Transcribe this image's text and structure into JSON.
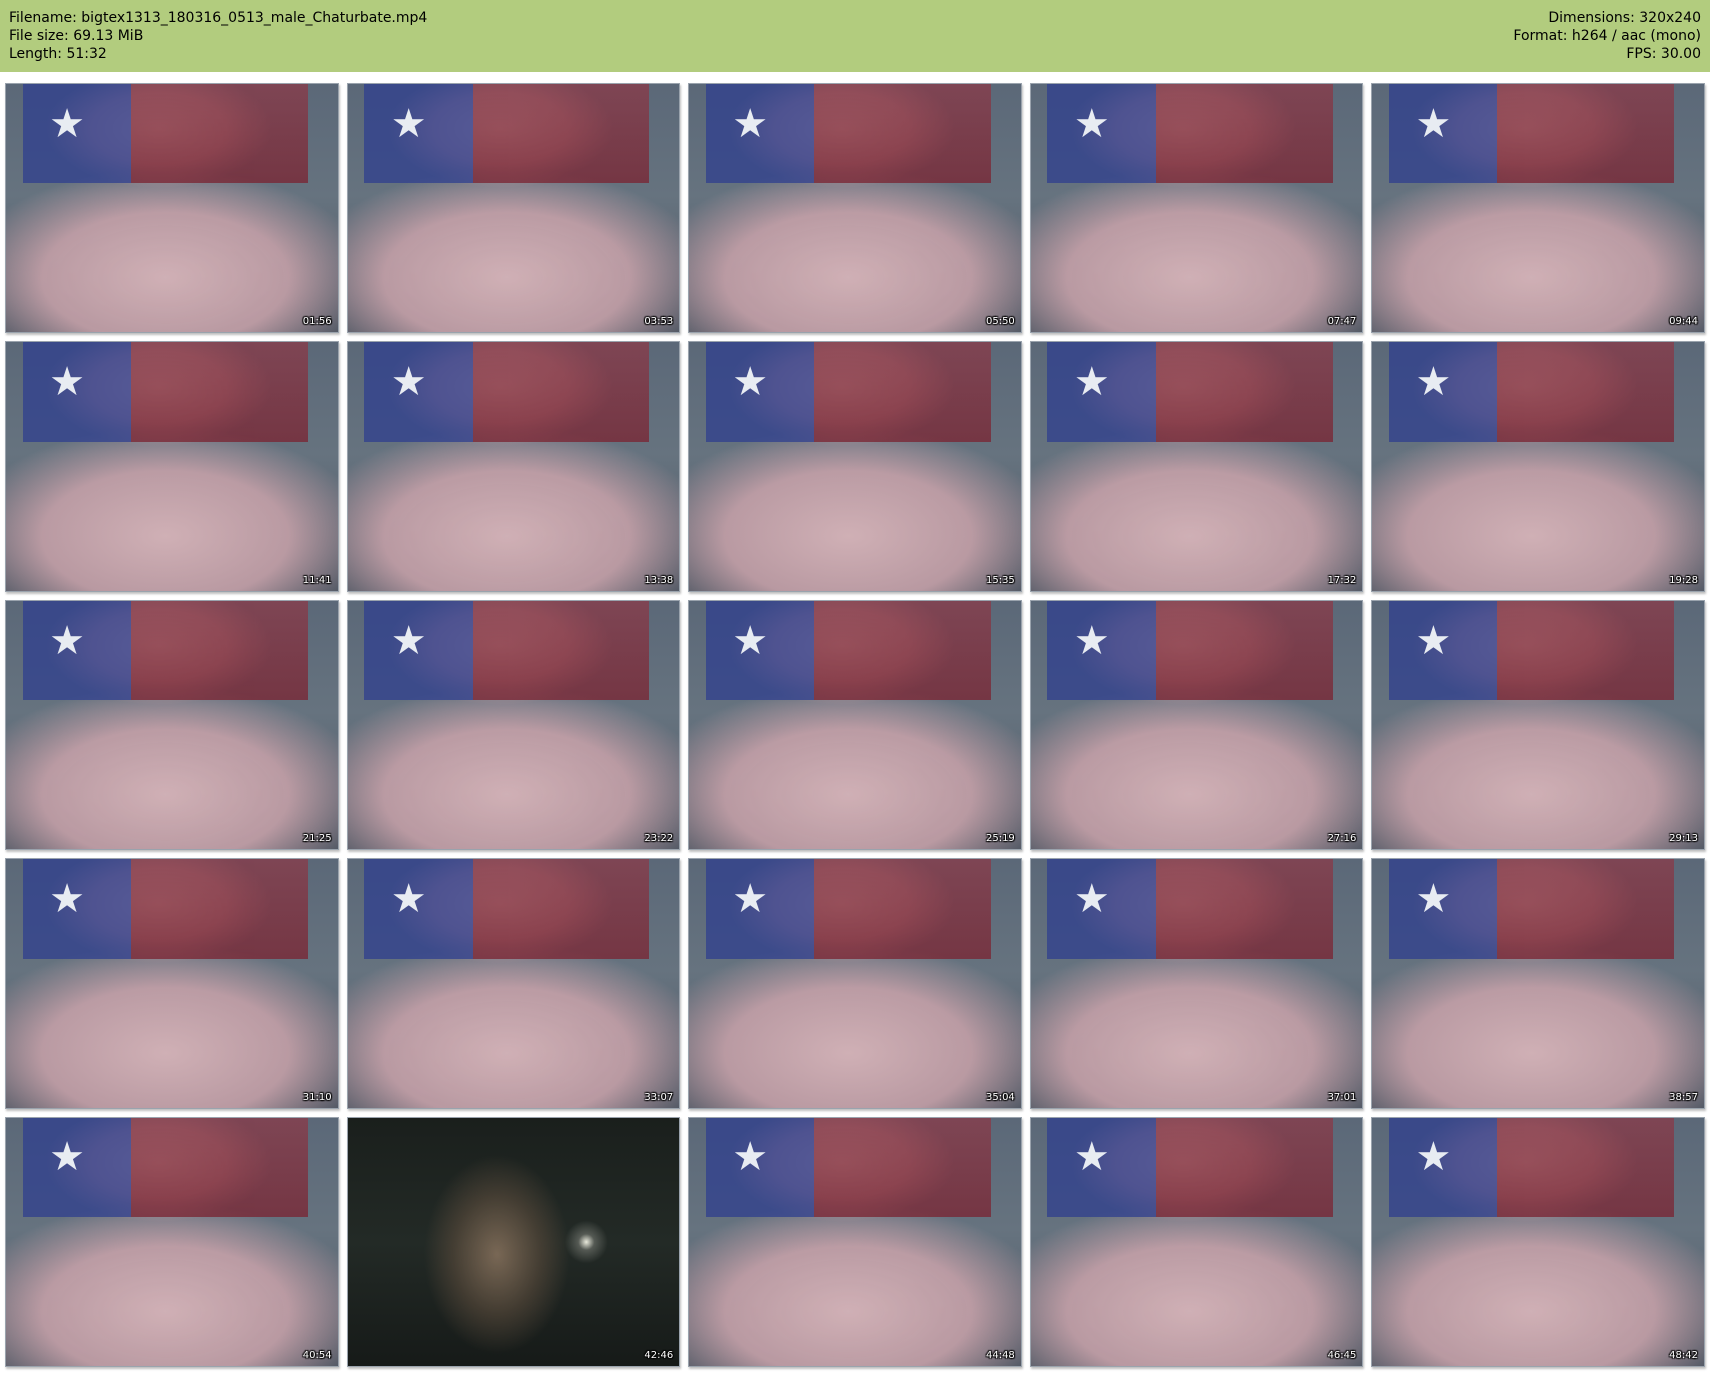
{
  "header": {
    "filename": "Filename: bigtex1313_180316_0513_male_Chaturbate.mp4",
    "file_size": "File size: 69.13 MiB",
    "length": "Length: 51:32",
    "dimensions": "Dimensions: 320x240",
    "format": "Format: h264 / aac (mono)",
    "fps": "FPS: 30.00",
    "bg_color": "#b2cc7e"
  },
  "thumbnails": [
    {
      "timestamp": "01:56"
    },
    {
      "timestamp": "03:53"
    },
    {
      "timestamp": "05:50"
    },
    {
      "timestamp": "07:47"
    },
    {
      "timestamp": "09:44"
    },
    {
      "timestamp": "11:41"
    },
    {
      "timestamp": "13:38"
    },
    {
      "timestamp": "15:35"
    },
    {
      "timestamp": "17:32"
    },
    {
      "timestamp": "19:28"
    },
    {
      "timestamp": "21:25"
    },
    {
      "timestamp": "23:22"
    },
    {
      "timestamp": "25:19"
    },
    {
      "timestamp": "27:16"
    },
    {
      "timestamp": "29:13"
    },
    {
      "timestamp": "31:10"
    },
    {
      "timestamp": "33:07"
    },
    {
      "timestamp": "35:04"
    },
    {
      "timestamp": "37:01"
    },
    {
      "timestamp": "38:57"
    },
    {
      "timestamp": "40:54"
    },
    {
      "timestamp": "42:46",
      "dark": true
    },
    {
      "timestamp": "44:48"
    },
    {
      "timestamp": "46:45"
    },
    {
      "timestamp": "48:42"
    }
  ]
}
